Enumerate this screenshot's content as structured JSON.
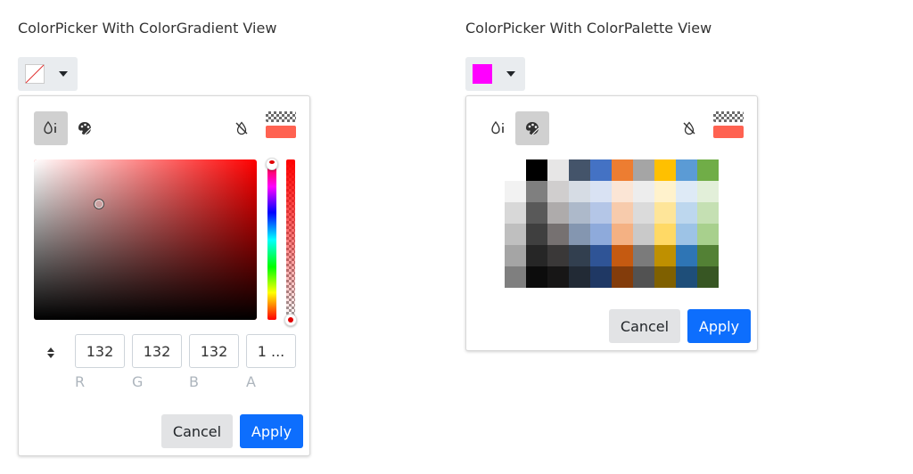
{
  "gradient_demo": {
    "title": "ColorPicker With ColorGradient View",
    "trigger_color": "none",
    "preview_new_color": "#ff6251",
    "gradient_base_color": "#ff0000",
    "handle": {
      "saturation": 0.29,
      "value": 0.72
    },
    "hue_level": 0.0,
    "alpha_level": 1.0,
    "inputs": [
      {
        "label": "R",
        "value": "132"
      },
      {
        "label": "G",
        "value": "132"
      },
      {
        "label": "B",
        "value": "132"
      },
      {
        "label": "A",
        "value": "1 ..."
      }
    ],
    "cancel_label": "Cancel",
    "apply_label": "Apply",
    "active_view": "gradient"
  },
  "palette_demo": {
    "title": "ColorPicker With ColorPalette View",
    "trigger_color": "#ff00ff",
    "preview_new_color": "#ff6251",
    "active_view": "palette",
    "palette": [
      [
        "#ffffff",
        "#000000",
        "#e7e6e6",
        "#44546a",
        "#4472c4",
        "#ed7d31",
        "#a5a5a5",
        "#ffc000",
        "#5b9bd5",
        "#70ad47"
      ],
      [
        "#f2f2f2",
        "#7f7f7f",
        "#d0cece",
        "#d6dce4",
        "#d9e2f3",
        "#fbe5d5",
        "#ededed",
        "#fff2cc",
        "#deeaf6",
        "#e2efd9"
      ],
      [
        "#d8d8d8",
        "#595959",
        "#aeabab",
        "#adb9ca",
        "#b4c6e7",
        "#f7cbac",
        "#dbdbdb",
        "#fee599",
        "#bdd7ee",
        "#c5e0b3"
      ],
      [
        "#bfbfbf",
        "#3f3f3f",
        "#767171",
        "#8496b0",
        "#8eaadb",
        "#f4b183",
        "#c9c9c9",
        "#ffd965",
        "#9dc3e6",
        "#a8d08d"
      ],
      [
        "#a5a5a5",
        "#262626",
        "#3a3838",
        "#323f4f",
        "#2f5496",
        "#c55a11",
        "#7b7b7b",
        "#bf9000",
        "#2e75b5",
        "#538135"
      ],
      [
        "#7f7f7f",
        "#0c0c0c",
        "#171616",
        "#222a35",
        "#1f3864",
        "#833c0b",
        "#525252",
        "#7f6000",
        "#1e4e79",
        "#375623"
      ]
    ],
    "cancel_label": "Cancel",
    "apply_label": "Apply"
  },
  "icons": {
    "gradient_mode": "droplet-icon",
    "palette_mode": "palette-icon",
    "no_color": "droplet-slash-icon",
    "toggle_inputs": "sort-arrows-icon",
    "trigger_caret": "caret-down-icon"
  }
}
